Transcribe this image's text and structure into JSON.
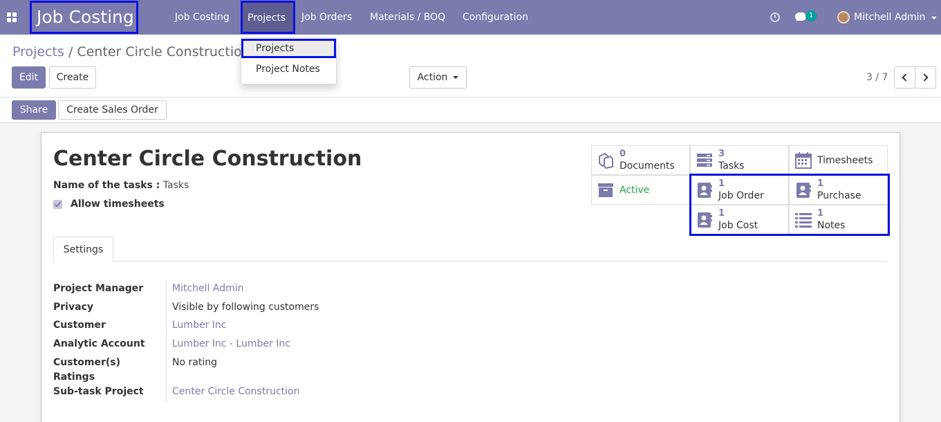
{
  "navbar": {
    "brand": "Job Costing",
    "menus": [
      "Job Costing",
      "Projects",
      "Job Orders",
      "Materials / BOQ",
      "Configuration"
    ],
    "chat_count": "1",
    "user": "Mitchell Admin"
  },
  "dropdown": {
    "items": [
      "Projects",
      "Project Notes"
    ]
  },
  "breadcrumb": {
    "parent": "Projects",
    "sep": "/",
    "current": "Center Circle Construction"
  },
  "buttons": {
    "edit": "Edit",
    "create": "Create",
    "action": "Action",
    "share": "Share",
    "create_sales_order": "Create Sales Order"
  },
  "pager": {
    "text": "3 / 7"
  },
  "record": {
    "title": "Center Circle Construction",
    "tasks_label": "Name of the tasks :",
    "tasks_value": "Tasks",
    "allow_timesheets": "Allow timesheets",
    "allow_timesheets_checked": true
  },
  "smart_buttons": {
    "documents": {
      "count": "0",
      "label": "Documents"
    },
    "tasks": {
      "count": "3",
      "label": "Tasks"
    },
    "timesheets": {
      "label": "Timesheets"
    },
    "active": {
      "label": "Active"
    },
    "job_order": {
      "count": "1",
      "label": "Job Order"
    },
    "purchase": {
      "count": "1",
      "label": "Purchase"
    },
    "job_cost": {
      "count": "1",
      "label": "Job Cost"
    },
    "notes": {
      "count": "1",
      "label": "Notes"
    }
  },
  "tabs": {
    "settings": "Settings"
  },
  "fields": {
    "project_manager": {
      "label": "Project Manager",
      "value": "Mitchell Admin"
    },
    "privacy": {
      "label": "Privacy",
      "value": "Visible by following customers"
    },
    "customer": {
      "label": "Customer",
      "value": "Lumber Inc"
    },
    "analytic_account": {
      "label": "Analytic Account",
      "value": "Lumber Inc - Lumber Inc"
    },
    "ratings": {
      "label": "Customer(s)",
      "label2": "Ratings",
      "value": "No rating"
    },
    "subtask_project": {
      "label": "Sub-task Project",
      "value": "Center Circle Construction"
    }
  },
  "colors": {
    "brand": "#7c7bad",
    "highlight": "#0a13e0",
    "active": "#28a745"
  }
}
